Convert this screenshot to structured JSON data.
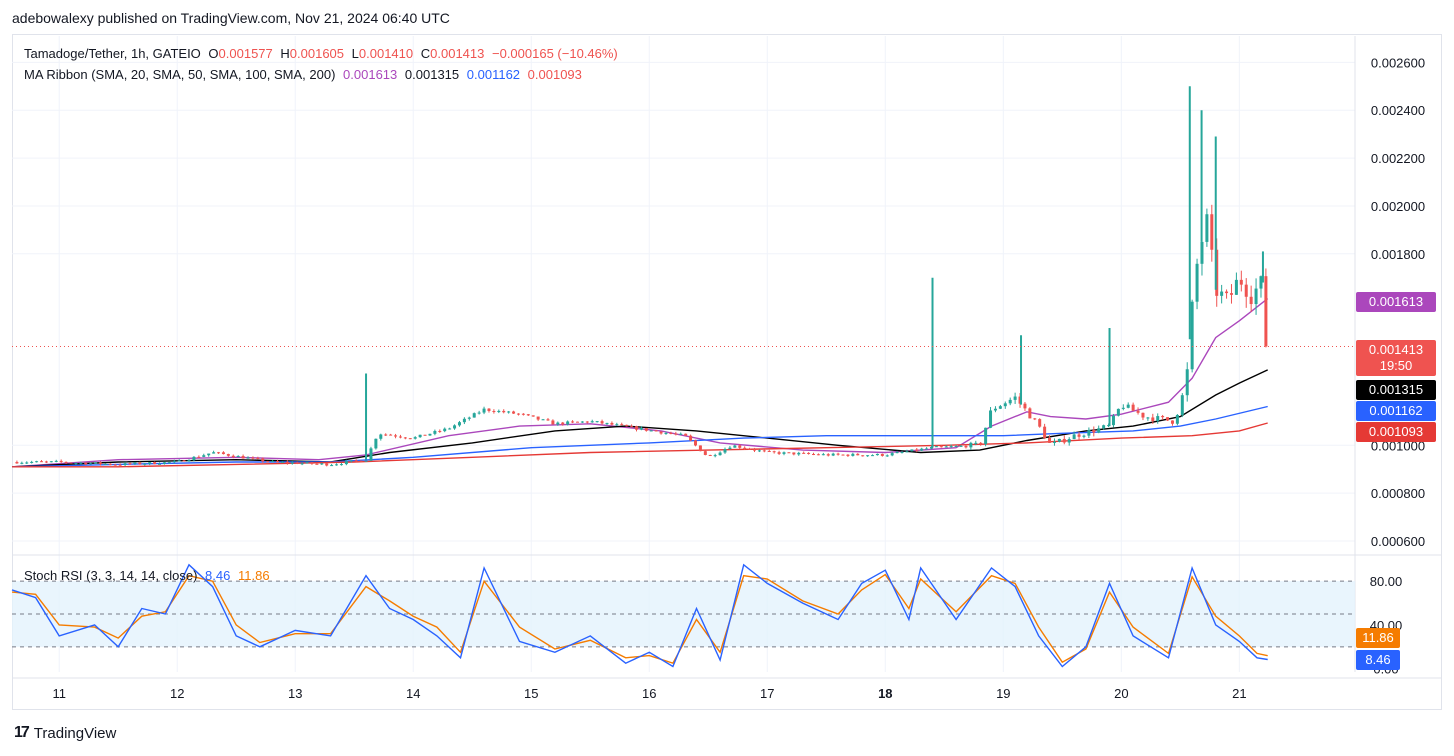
{
  "publisher_line": "adebowalexy published on TradingView.com, Nov 21, 2024 06:40 UTC",
  "legend": {
    "symbol": "Tamadoge/Tether, 1h, GATEIO",
    "o_label": "O",
    "o_value": "0.001577",
    "h_label": "H",
    "h_value": "0.001605",
    "l_label": "L",
    "l_value": "0.001410",
    "c_label": "C",
    "c_value": "0.001413",
    "change": "−0.000165 (−10.46%)",
    "ma_label": "MA Ribbon (SMA, 20, SMA, 50, SMA, 100, SMA, 200)",
    "ma20": "0.001613",
    "ma50": "0.001315",
    "ma100": "0.001162",
    "ma200": "0.001093"
  },
  "stoch_legend": {
    "label": "Stoch RSI (3, 3, 14, 14, close)",
    "k": "8.46",
    "d": "11.86"
  },
  "price_tags": {
    "ma20": "0.001613",
    "last": "0.001413",
    "countdown": "19:50",
    "ma50": "0.001315",
    "ma100": "0.001162",
    "ma200": "0.001093"
  },
  "stoch_tags": {
    "d": "11.86",
    "k": "8.46"
  },
  "branding": "TradingView",
  "colors": {
    "up": "#26a69a",
    "down": "#ef5350",
    "ma20": "#ab47bc",
    "ma50": "#000000",
    "ma100": "#2962ff",
    "ma200": "#e53935",
    "stoch_k": "#2962ff",
    "stoch_d": "#f57c00",
    "band": "#e3f2fd"
  },
  "chart_data": [
    {
      "type": "candlestick",
      "title": "Tamadoge/Tether, 1h, GATEIO",
      "x_ticks": [
        "11",
        "12",
        "13",
        "14",
        "15",
        "16",
        "17",
        "18",
        "19",
        "20",
        "21"
      ],
      "y_ticks": [
        "0.002600",
        "0.002400",
        "0.002200",
        "0.002000",
        "0.001800",
        "0.000800",
        "0.000600"
      ],
      "y_tick_values": [
        0.0026,
        0.0024,
        0.0022,
        0.002,
        0.0018,
        0.001,
        0.0008,
        0.0006
      ],
      "y_extra_tick": "0.001000",
      "ylim": [
        0.00055,
        0.00271
      ],
      "x_range_days": [
        10.6,
        21.98
      ],
      "last_close": 0.001413,
      "grid": true,
      "ohlc_anchors_day_price": [
        [
          10.6,
          0.00093
        ],
        [
          11.0,
          0.00093
        ],
        [
          11.5,
          0.00092
        ],
        [
          12.0,
          0.00093
        ],
        [
          12.3,
          0.00097
        ],
        [
          12.8,
          0.00093
        ],
        [
          13.3,
          0.00092
        ],
        [
          13.6,
          0.00094
        ],
        [
          13.7,
          0.00105
        ],
        [
          14.0,
          0.00103
        ],
        [
          14.3,
          0.00107
        ],
        [
          14.6,
          0.00115
        ],
        [
          14.9,
          0.00113
        ],
        [
          15.2,
          0.00109
        ],
        [
          15.5,
          0.0011
        ],
        [
          15.9,
          0.00107
        ],
        [
          16.3,
          0.00104
        ],
        [
          16.5,
          0.00095
        ],
        [
          16.7,
          0.001
        ],
        [
          17.0,
          0.00097
        ],
        [
          17.5,
          0.00096
        ],
        [
          18.0,
          0.00096
        ],
        [
          18.4,
          0.00099
        ],
        [
          18.8,
          0.001
        ],
        [
          18.9,
          0.00115
        ],
        [
          19.1,
          0.0012
        ],
        [
          19.3,
          0.00108
        ],
        [
          19.4,
          0.001
        ],
        [
          19.6,
          0.00104
        ],
        [
          19.9,
          0.00108
        ],
        [
          20.0,
          0.00117
        ],
        [
          20.2,
          0.00112
        ],
        [
          20.45,
          0.0011
        ],
        [
          20.55,
          0.00125
        ],
        [
          20.62,
          0.0017
        ],
        [
          20.72,
          0.00195
        ],
        [
          20.8,
          0.00165
        ],
        [
          20.9,
          0.0016
        ],
        [
          21.0,
          0.0017
        ],
        [
          21.1,
          0.00163
        ],
        [
          21.2,
          0.00168
        ],
        [
          21.22,
          0.00158
        ],
        [
          21.24,
          0.001413
        ]
      ],
      "spike_wicks_day_high": [
        [
          13.6,
          0.0013
        ],
        [
          18.4,
          0.0017
        ],
        [
          19.15,
          0.00146
        ],
        [
          19.9,
          0.00149
        ],
        [
          20.58,
          0.0025
        ],
        [
          20.68,
          0.0024
        ],
        [
          20.8,
          0.00229
        ],
        [
          21.2,
          0.00181
        ]
      ],
      "series": [
        {
          "name": "SMA 20",
          "points_day_value": [
            [
              10.6,
              0.00091
            ],
            [
              11.5,
              0.00094
            ],
            [
              12.5,
              0.00095
            ],
            [
              13.2,
              0.00094
            ],
            [
              13.6,
              0.00096
            ],
            [
              14.3,
              0.00104
            ],
            [
              14.9,
              0.00108
            ],
            [
              15.5,
              0.00109
            ],
            [
              16.1,
              0.00106
            ],
            [
              16.6,
              0.00101
            ],
            [
              17.3,
              0.00098
            ],
            [
              18.0,
              0.00097
            ],
            [
              18.6,
              0.00099
            ],
            [
              18.9,
              0.00108
            ],
            [
              19.2,
              0.00114
            ],
            [
              19.4,
              0.00112
            ],
            [
              19.7,
              0.00111
            ],
            [
              20.0,
              0.00113
            ],
            [
              20.4,
              0.00118
            ],
            [
              20.6,
              0.00128
            ],
            [
              20.8,
              0.00145
            ],
            [
              21.0,
              0.00152
            ],
            [
              21.24,
              0.001613
            ]
          ]
        },
        {
          "name": "SMA 50",
          "points_day_value": [
            [
              10.6,
              0.00091
            ],
            [
              11.5,
              0.00093
            ],
            [
              12.5,
              0.00094
            ],
            [
              13.3,
              0.00093
            ],
            [
              13.8,
              0.00097
            ],
            [
              14.5,
              0.00101
            ],
            [
              15.2,
              0.00106
            ],
            [
              15.8,
              0.00108
            ],
            [
              16.4,
              0.00106
            ],
            [
              17.0,
              0.00103
            ],
            [
              17.6,
              0.001
            ],
            [
              18.3,
              0.00097
            ],
            [
              18.8,
              0.00098
            ],
            [
              19.2,
              0.00102
            ],
            [
              19.7,
              0.00106
            ],
            [
              20.1,
              0.00108
            ],
            [
              20.5,
              0.00112
            ],
            [
              20.8,
              0.00121
            ],
            [
              21.0,
              0.00126
            ],
            [
              21.24,
              0.001315
            ]
          ]
        },
        {
          "name": "SMA 100",
          "points_day_value": [
            [
              10.6,
              0.00091
            ],
            [
              11.5,
              0.00092
            ],
            [
              12.5,
              0.00093
            ],
            [
              13.3,
              0.00093
            ],
            [
              14.0,
              0.00095
            ],
            [
              15.0,
              0.00099
            ],
            [
              16.0,
              0.00101
            ],
            [
              16.8,
              0.00103
            ],
            [
              17.5,
              0.00104
            ],
            [
              18.3,
              0.00104
            ],
            [
              19.0,
              0.00104
            ],
            [
              19.5,
              0.00105
            ],
            [
              20.1,
              0.00106
            ],
            [
              20.5,
              0.00108
            ],
            [
              20.8,
              0.00111
            ],
            [
              21.24,
              0.001162
            ]
          ]
        },
        {
          "name": "SMA 200",
          "points_day_value": [
            [
              10.6,
              0.00091
            ],
            [
              11.5,
              0.00091
            ],
            [
              12.5,
              0.00092
            ],
            [
              13.5,
              0.00093
            ],
            [
              14.5,
              0.00095
            ],
            [
              15.5,
              0.00097
            ],
            [
              16.5,
              0.00098
            ],
            [
              17.5,
              0.00099
            ],
            [
              18.5,
              0.001
            ],
            [
              19.2,
              0.00101
            ],
            [
              20.0,
              0.00103
            ],
            [
              20.6,
              0.00104
            ],
            [
              21.0,
              0.00106
            ],
            [
              21.24,
              0.001093
            ]
          ]
        }
      ]
    },
    {
      "type": "line",
      "title": "Stoch RSI (3, 3, 14, 14, close)",
      "y_ticks": [
        "80.00",
        "40.00",
        "0.00"
      ],
      "y_tick_values": [
        80,
        40,
        0
      ],
      "ylim": [
        -3,
        103
      ],
      "band": [
        20,
        80
      ],
      "series": [
        {
          "name": "K",
          "last": 8.46,
          "points_day_value": [
            [
              10.6,
              72
            ],
            [
              10.8,
              65
            ],
            [
              11.0,
              30
            ],
            [
              11.3,
              40
            ],
            [
              11.5,
              20
            ],
            [
              11.7,
              55
            ],
            [
              11.9,
              50
            ],
            [
              12.1,
              95
            ],
            [
              12.3,
              75
            ],
            [
              12.5,
              30
            ],
            [
              12.7,
              20
            ],
            [
              13.0,
              35
            ],
            [
              13.3,
              30
            ],
            [
              13.6,
              85
            ],
            [
              13.8,
              55
            ],
            [
              14.0,
              45
            ],
            [
              14.2,
              30
            ],
            [
              14.4,
              10
            ],
            [
              14.6,
              92
            ],
            [
              14.9,
              25
            ],
            [
              15.2,
              15
            ],
            [
              15.5,
              30
            ],
            [
              15.8,
              5
            ],
            [
              16.0,
              15
            ],
            [
              16.2,
              2
            ],
            [
              16.4,
              55
            ],
            [
              16.6,
              8
            ],
            [
              16.8,
              95
            ],
            [
              17.0,
              78
            ],
            [
              17.3,
              60
            ],
            [
              17.6,
              45
            ],
            [
              17.8,
              78
            ],
            [
              18.0,
              90
            ],
            [
              18.2,
              45
            ],
            [
              18.3,
              92
            ],
            [
              18.6,
              45
            ],
            [
              18.9,
              92
            ],
            [
              19.1,
              75
            ],
            [
              19.3,
              30
            ],
            [
              19.5,
              2
            ],
            [
              19.7,
              20
            ],
            [
              19.9,
              78
            ],
            [
              20.1,
              30
            ],
            [
              20.4,
              10
            ],
            [
              20.6,
              92
            ],
            [
              20.8,
              40
            ],
            [
              21.0,
              25
            ],
            [
              21.15,
              10
            ],
            [
              21.24,
              8.46
            ]
          ]
        },
        {
          "name": "D",
          "last": 11.86,
          "points_day_value": [
            [
              10.6,
              70
            ],
            [
              10.8,
              68
            ],
            [
              11.0,
              40
            ],
            [
              11.3,
              38
            ],
            [
              11.5,
              28
            ],
            [
              11.7,
              48
            ],
            [
              11.9,
              52
            ],
            [
              12.1,
              85
            ],
            [
              12.3,
              80
            ],
            [
              12.5,
              40
            ],
            [
              12.7,
              24
            ],
            [
              13.0,
              32
            ],
            [
              13.3,
              32
            ],
            [
              13.6,
              75
            ],
            [
              13.8,
              62
            ],
            [
              14.0,
              48
            ],
            [
              14.2,
              38
            ],
            [
              14.4,
              15
            ],
            [
              14.6,
              80
            ],
            [
              14.9,
              38
            ],
            [
              15.2,
              18
            ],
            [
              15.5,
              26
            ],
            [
              15.8,
              10
            ],
            [
              16.0,
              12
            ],
            [
              16.2,
              5
            ],
            [
              16.4,
              45
            ],
            [
              16.6,
              15
            ],
            [
              16.8,
              85
            ],
            [
              17.0,
              82
            ],
            [
              17.3,
              62
            ],
            [
              17.6,
              50
            ],
            [
              17.8,
              72
            ],
            [
              18.0,
              86
            ],
            [
              18.2,
              55
            ],
            [
              18.3,
              82
            ],
            [
              18.6,
              52
            ],
            [
              18.9,
              85
            ],
            [
              19.1,
              78
            ],
            [
              19.3,
              38
            ],
            [
              19.5,
              6
            ],
            [
              19.7,
              18
            ],
            [
              19.9,
              70
            ],
            [
              20.1,
              38
            ],
            [
              20.4,
              14
            ],
            [
              20.6,
              84
            ],
            [
              20.8,
              48
            ],
            [
              21.0,
              30
            ],
            [
              21.15,
              14
            ],
            [
              21.24,
              11.86
            ]
          ]
        }
      ]
    }
  ]
}
